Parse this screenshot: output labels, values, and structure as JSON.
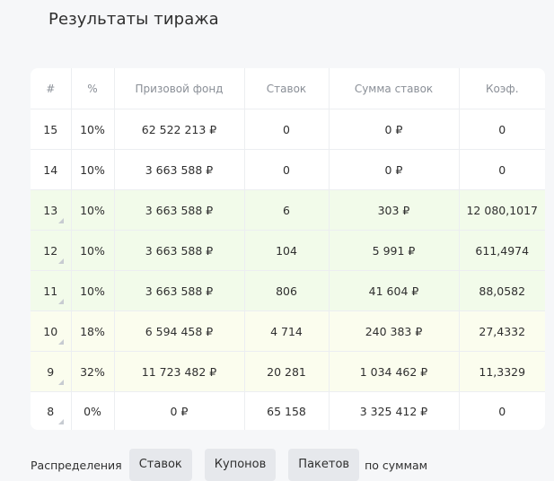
{
  "title": "Результаты тиража",
  "table": {
    "headers": [
      "#",
      "%",
      "Призовой фонд",
      "Ставок",
      "Сумма ставок",
      "Коэф."
    ],
    "rows": [
      {
        "n": "15",
        "pct": "10%",
        "fund": "62 522 213 ₽",
        "bets": "0",
        "sum": "0 ₽",
        "coef": "0",
        "tint": "",
        "corner": false
      },
      {
        "n": "14",
        "pct": "10%",
        "fund": "3 663 588 ₽",
        "bets": "0",
        "sum": "0 ₽",
        "coef": "0",
        "tint": "",
        "corner": false
      },
      {
        "n": "13",
        "pct": "10%",
        "fund": "3 663 588 ₽",
        "bets": "6",
        "sum": "303 ₽",
        "coef": "12 080,1017",
        "tint": "green",
        "corner": true
      },
      {
        "n": "12",
        "pct": "10%",
        "fund": "3 663 588 ₽",
        "bets": "104",
        "sum": "5 991 ₽",
        "coef": "611,4974",
        "tint": "green",
        "corner": true
      },
      {
        "n": "11",
        "pct": "10%",
        "fund": "3 663 588 ₽",
        "bets": "806",
        "sum": "41 604 ₽",
        "coef": "88,0582",
        "tint": "green",
        "corner": true
      },
      {
        "n": "10",
        "pct": "18%",
        "fund": "6 594 458 ₽",
        "bets": "4 714",
        "sum": "240 383 ₽",
        "coef": "27,4332",
        "tint": "yellow",
        "corner": true
      },
      {
        "n": "9",
        "pct": "32%",
        "fund": "11 723 482 ₽",
        "bets": "20 281",
        "sum": "1 034 462 ₽",
        "coef": "11,3329",
        "tint": "yellow",
        "corner": true
      },
      {
        "n": "8",
        "pct": "0%",
        "fund": "0 ₽",
        "bets": "65 158",
        "sum": "3 325 412 ₽",
        "coef": "0",
        "tint": "",
        "corner": true
      }
    ]
  },
  "footer": {
    "label": "Распределения",
    "buttons": [
      "Ставок",
      "Купонов",
      "Пакетов"
    ],
    "tail": "по суммам"
  },
  "colors": {
    "green_row": "#f2fbea",
    "yellow_row": "#fbfdee",
    "button_bg": "#e6e8ec"
  }
}
